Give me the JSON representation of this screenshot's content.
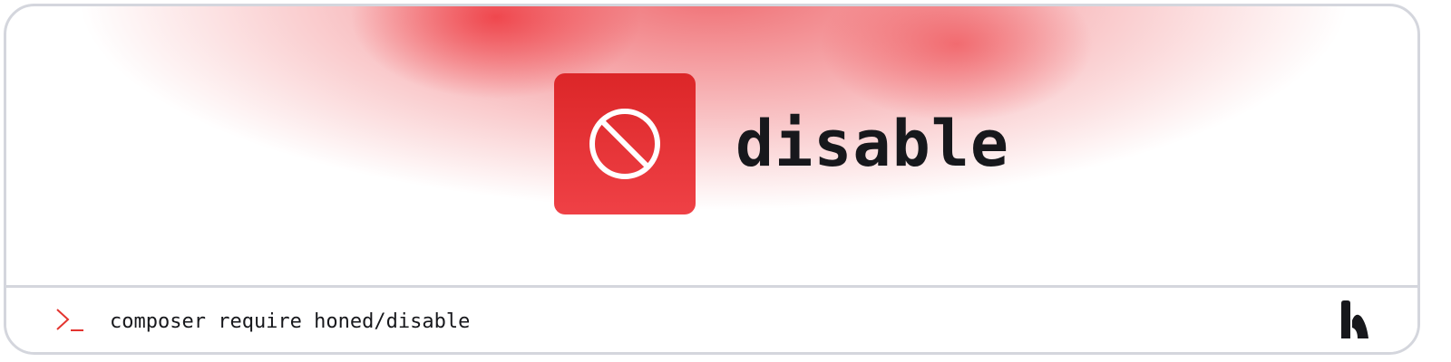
{
  "package": {
    "name": "disable",
    "icon": "disable-circle-slash-icon",
    "tile_color": "#e0292c",
    "glow_color": "#ec4a50"
  },
  "footer": {
    "prompt_icon": "terminal-prompt-icon",
    "prompt_color": "#e3342f",
    "command": "composer require honed/disable",
    "logo_icon": "honed-logo-icon"
  }
}
